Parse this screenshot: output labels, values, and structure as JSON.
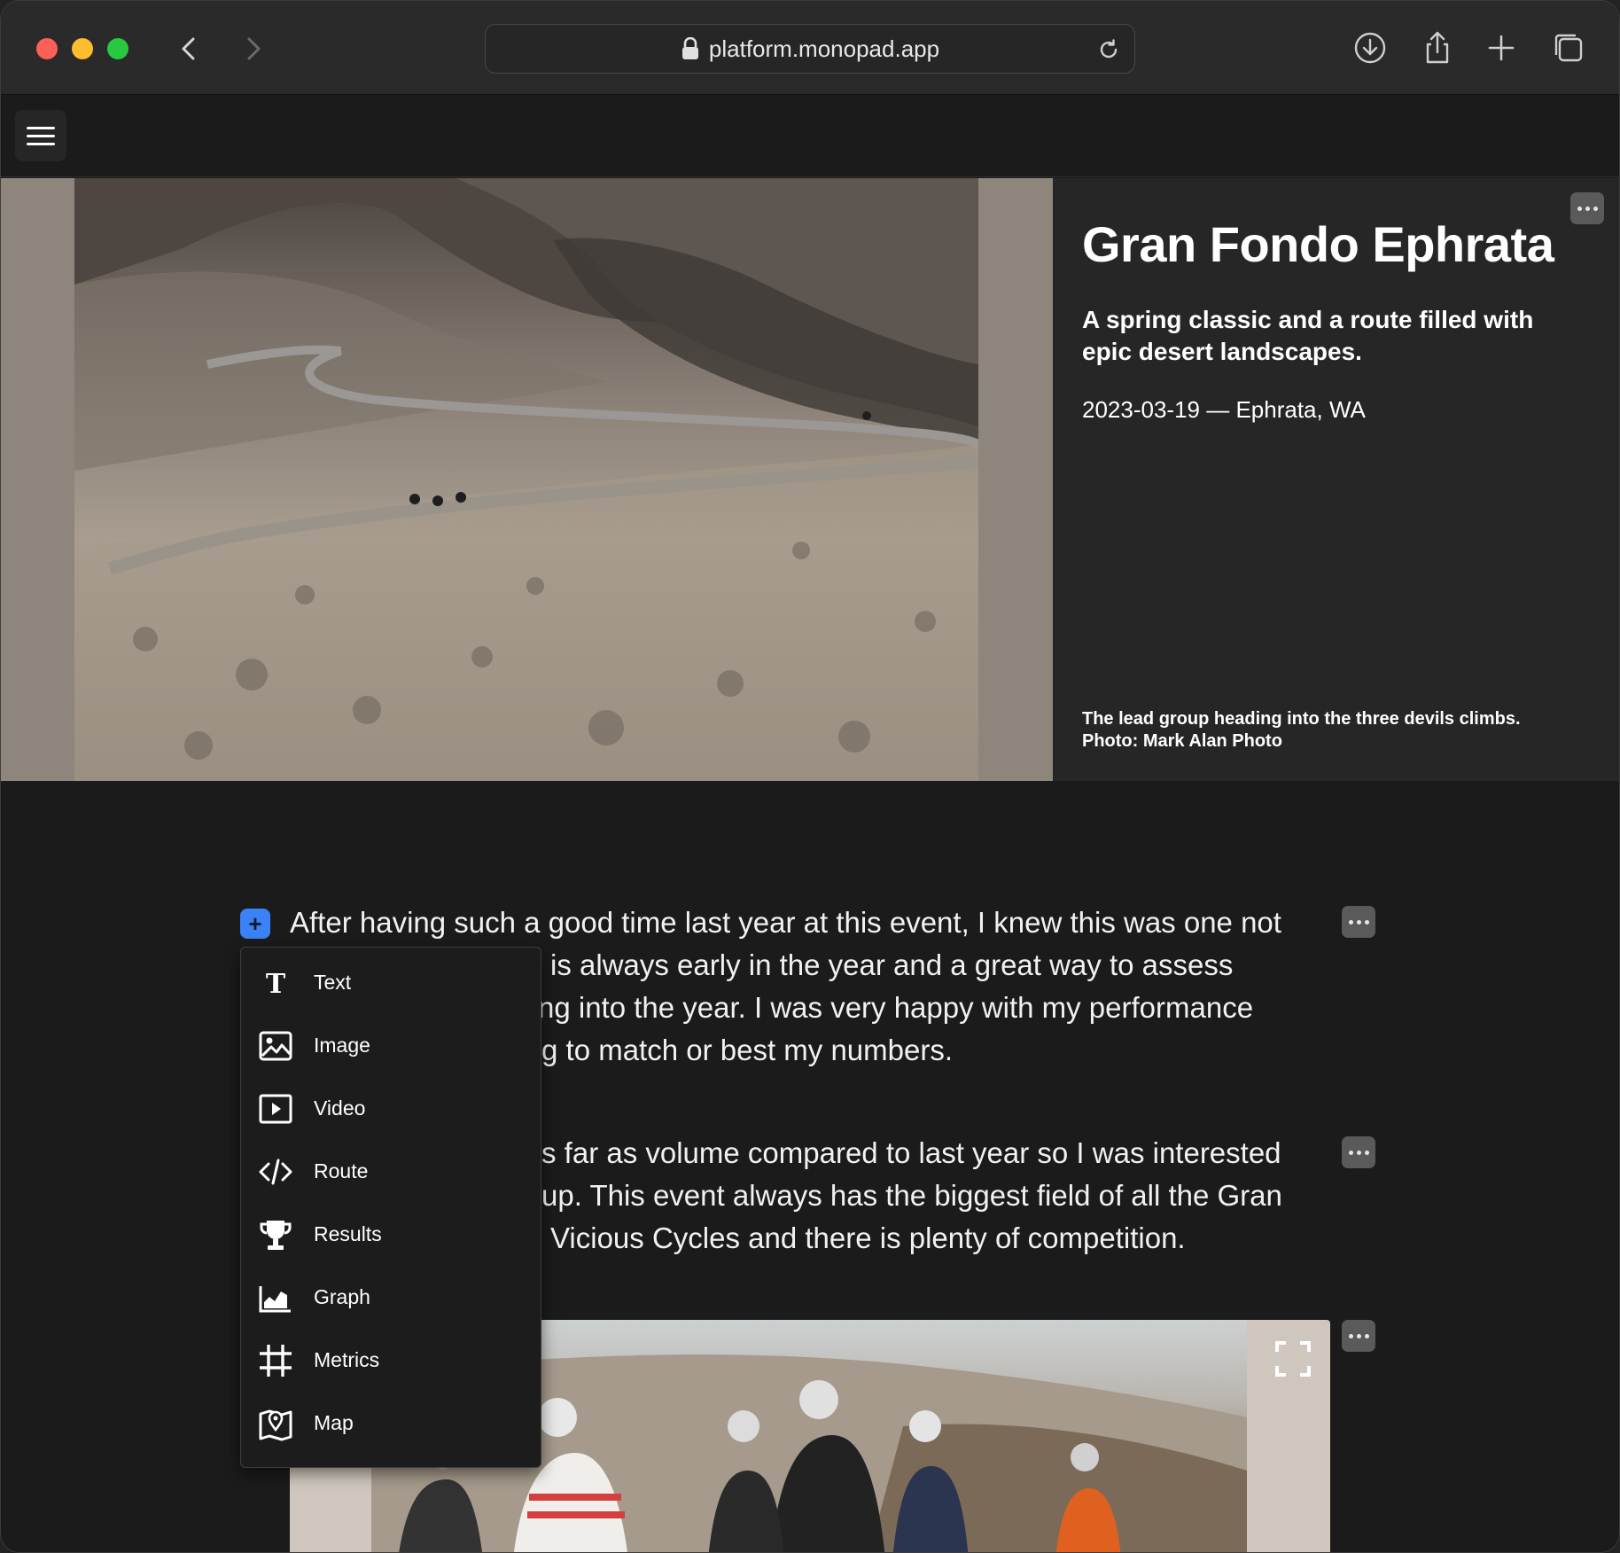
{
  "browser": {
    "url": "platform.monopad.app"
  },
  "hero": {
    "title": "Gran Fondo Ephrata",
    "subtitle": "A spring classic and a route filled with epic desert landscapes.",
    "date_location": "2023-03-19 — Ephrata, WA",
    "caption_line1": "The lead group heading into the three devils climbs.",
    "caption_line2": "Photo: Mark Alan Photo"
  },
  "paragraphs": [
    {
      "lines": [
        "After having such a good time last year at this event, I knew this was one not",
        "is always early in the year and a great way to assess",
        "ng into the year. I was very happy with my performance",
        "g to match or best my numbers."
      ]
    },
    {
      "lines": [
        "s far as volume compared to last year so I was interested",
        "up. This event always has the biggest field of all the Gran",
        "Vicious Cycles and there is plenty of competition."
      ]
    }
  ],
  "menu": {
    "items": [
      {
        "label": "Text",
        "icon": "text-icon"
      },
      {
        "label": "Image",
        "icon": "image-icon"
      },
      {
        "label": "Video",
        "icon": "video-icon"
      },
      {
        "label": "Route",
        "icon": "code-icon"
      },
      {
        "label": "Results",
        "icon": "trophy-icon"
      },
      {
        "label": "Graph",
        "icon": "area-chart-icon"
      },
      {
        "label": "Metrics",
        "icon": "grid-icon"
      },
      {
        "label": "Map",
        "icon": "map-icon"
      }
    ]
  },
  "add_button": {
    "label": "+"
  },
  "colors": {
    "accent": "#3b82f6",
    "background": "#1b1b1b",
    "hero_panel": "#262626"
  }
}
